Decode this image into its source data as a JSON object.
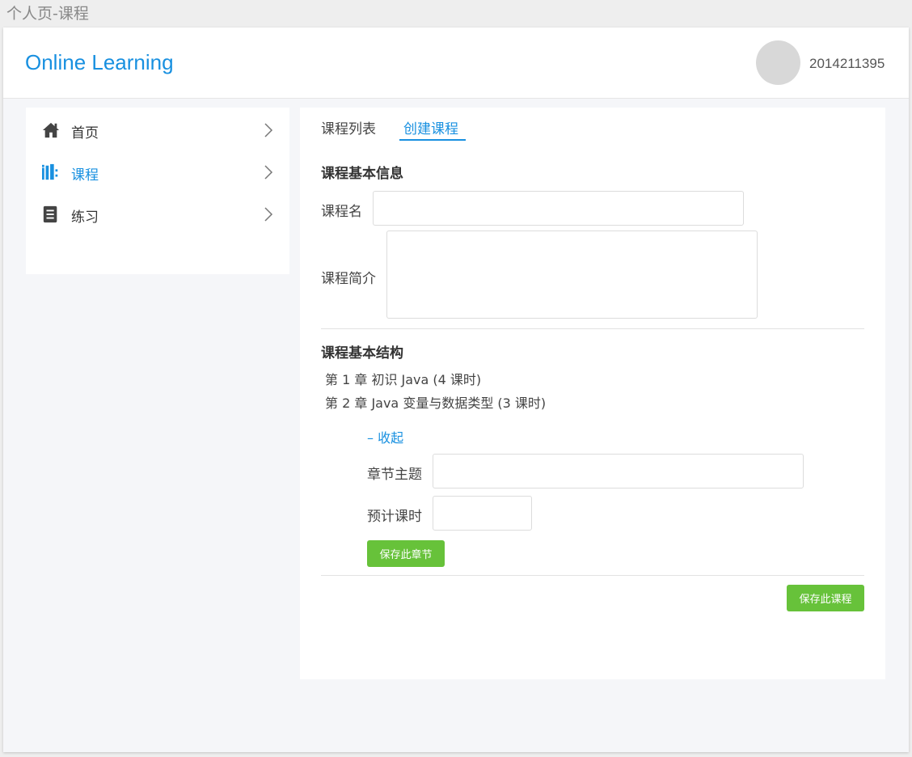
{
  "page_caption": "个人页-课程",
  "header": {
    "brand": "Online Learning",
    "user_id": "2014211395"
  },
  "sidebar": {
    "items": [
      {
        "label": "首页",
        "icon": "home-icon",
        "active": false
      },
      {
        "label": "课程",
        "icon": "books-icon",
        "active": true
      },
      {
        "label": "练习",
        "icon": "list-icon",
        "active": false
      }
    ]
  },
  "tabs": {
    "list": "课程列表",
    "create": "创建课程",
    "active": "create"
  },
  "basic_info": {
    "title": "课程基本信息",
    "name_label": "课程名",
    "name_value": "",
    "intro_label": "课程简介",
    "intro_value": ""
  },
  "structure": {
    "title": "课程基本结构",
    "chapters": [
      "第 1 章 初识 Java (4 课时)",
      "第 2 章 Java 变量与数据类型  (3 课时)"
    ],
    "collapse_label": "– 收起",
    "topic_label": "章节主题",
    "topic_value": "",
    "hours_label": "预计课时",
    "hours_value": "",
    "save_chapter": "保存此章节"
  },
  "save_course": "保存此课程",
  "colors": {
    "accent": "#1890e0",
    "success": "#67c23a"
  }
}
